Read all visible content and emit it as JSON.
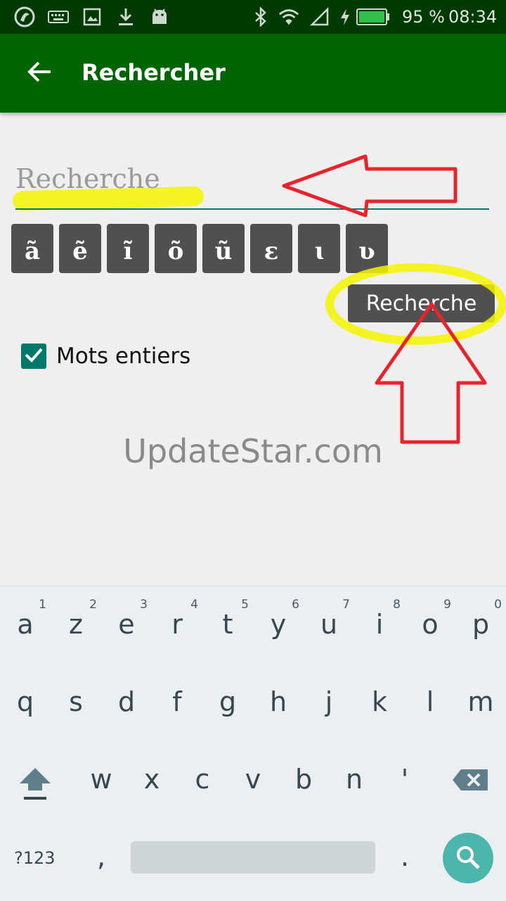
{
  "status_bar": {
    "battery_percent": "95 %",
    "time": "08:34",
    "icons": [
      "app-logo-icon",
      "keyboard-icon",
      "image-icon",
      "download-icon",
      "android-icon",
      "bluetooth-icon",
      "wifi-icon",
      "signal-icon",
      "charging-icon",
      "battery-icon"
    ]
  },
  "app_bar": {
    "title": "Rechercher",
    "color": "#006400"
  },
  "search": {
    "placeholder": "Recherche",
    "value": ""
  },
  "special_chars": [
    "ã",
    "ẽ",
    "ĩ",
    "õ",
    "ũ",
    "ɛ",
    "ɩ",
    "ʋ"
  ],
  "search_button": {
    "label": "Recherche"
  },
  "whole_words": {
    "label": "Mots entiers",
    "checked": true
  },
  "watermark": "UpdateStar.com",
  "keyboard": {
    "row1": [
      {
        "key": "a",
        "hint": "1"
      },
      {
        "key": "z",
        "hint": "2"
      },
      {
        "key": "e",
        "hint": "3"
      },
      {
        "key": "r",
        "hint": "4"
      },
      {
        "key": "t",
        "hint": "5"
      },
      {
        "key": "y",
        "hint": "6"
      },
      {
        "key": "u",
        "hint": "7"
      },
      {
        "key": "i",
        "hint": "8"
      },
      {
        "key": "o",
        "hint": "9"
      },
      {
        "key": "p",
        "hint": "0"
      }
    ],
    "row2": [
      "q",
      "s",
      "d",
      "f",
      "g",
      "h",
      "j",
      "k",
      "l",
      "m"
    ],
    "row3": [
      "w",
      "x",
      "c",
      "v",
      "b",
      "n",
      "'"
    ],
    "symbols_label": "?123",
    "comma": ",",
    "period": ".",
    "accent_color": "#4db6ac"
  }
}
